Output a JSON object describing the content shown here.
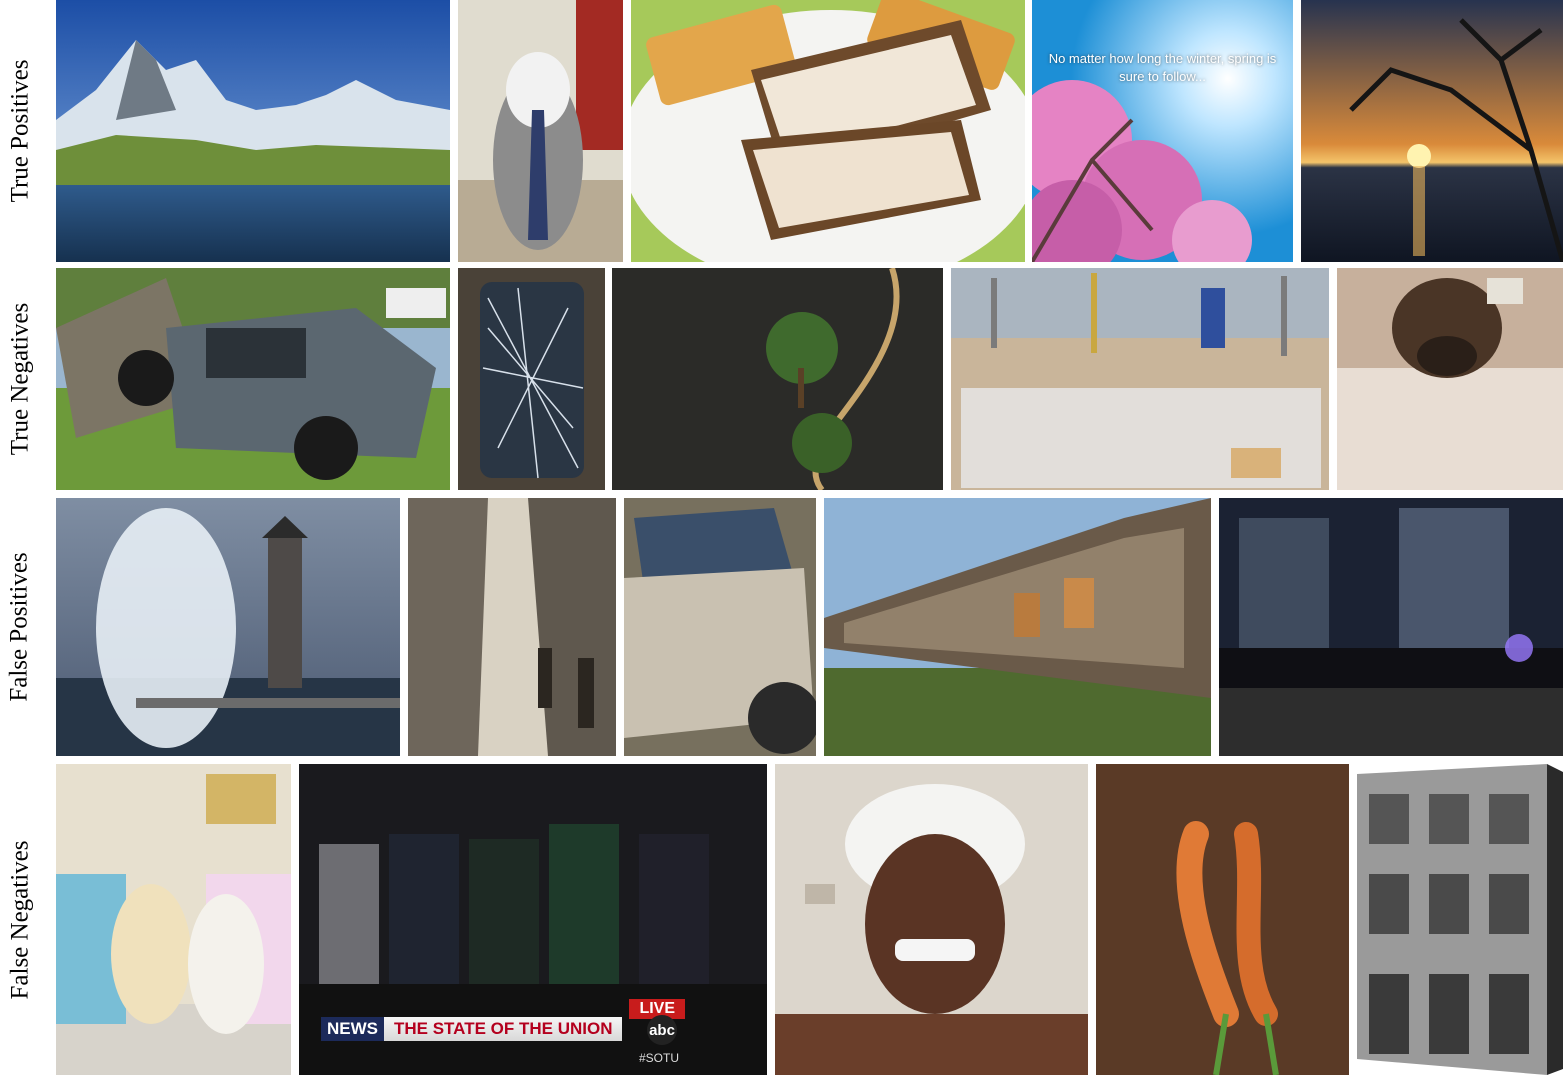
{
  "rows": [
    {
      "label": "True Positives"
    },
    {
      "label": "True Negatives"
    },
    {
      "label": "False Positives"
    },
    {
      "label": "False Negatives"
    }
  ],
  "overlays": {
    "spring_quote": "No matter how long the winter, spring is sure to follow...",
    "news_brand": "NEWS",
    "news_title": "THE STATE OF THE UNION",
    "live": "LIVE",
    "abc": "abc",
    "hashtag": "#SOTU"
  }
}
